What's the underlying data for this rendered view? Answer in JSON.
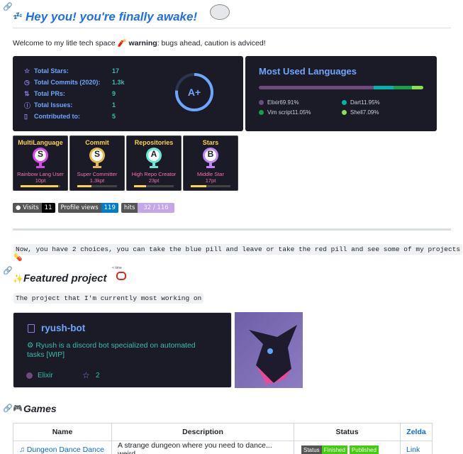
{
  "intro": {
    "title": "Hey you! you're finally awake!",
    "welcome_prefix": "Welcome to my litle tech space ",
    "warning_label": "warning",
    "welcome_suffix": ": bugs ahead, caution is adviced!"
  },
  "stats": {
    "rows": [
      {
        "icon": "star-icon",
        "label": "Total Stars:",
        "value": "17"
      },
      {
        "icon": "clock-icon",
        "label": "Total Commits (2020):",
        "value": "1.3k"
      },
      {
        "icon": "pull-request-icon",
        "label": "Total PRs:",
        "value": "9"
      },
      {
        "icon": "issue-icon",
        "label": "Total Issues:",
        "value": "1"
      },
      {
        "icon": "repo-icon",
        "label": "Contributed to:",
        "value": "5"
      }
    ],
    "grade": "A+",
    "colors": {
      "bg": "#1a1b27",
      "label": "#70a5fd",
      "value": "#38bdae",
      "ring": "#70a5fd"
    }
  },
  "languages": {
    "title": "Most Used Languages",
    "items": [
      {
        "name": "Elixir",
        "percent": "69.91%",
        "value": 69.91,
        "color": "#6e4a7e"
      },
      {
        "name": "Dart",
        "percent": "11.95%",
        "value": 11.95,
        "color": "#00B4AB"
      },
      {
        "name": "Vim script",
        "percent": "11.05%",
        "value": 11.05,
        "color": "#199f4b"
      },
      {
        "name": "Shell",
        "percent": "7.09%",
        "value": 7.09,
        "color": "#89e051"
      }
    ]
  },
  "trophies": [
    {
      "title": "MultiLanguage",
      "rank": "S",
      "subtitle": "Rainbow Lang User",
      "points": "10pt",
      "progress": 0.95,
      "cup_color": "#d946ef"
    },
    {
      "title": "Commit",
      "rank": "S",
      "subtitle": "Super Committer",
      "points": "1.3kpt",
      "progress": 0.35,
      "cup_color": "#e5b84b"
    },
    {
      "title": "Repositories",
      "rank": "A",
      "subtitle": "High Repo Creator",
      "points": "23pt",
      "progress": 0.3,
      "cup_color": "#5eead4"
    },
    {
      "title": "Stars",
      "rank": "B",
      "subtitle": "Middle Star",
      "points": "17pt",
      "progress": 0.4,
      "cup_color": "#c084fc"
    }
  ],
  "badges": {
    "visits_label": "Visits",
    "visits_value": "11",
    "profile_label": "Profile views",
    "profile_value": "119",
    "hits_label": "hits",
    "hits_value": "32 / 116"
  },
  "choices_text": "Now, you have 2 choices, you can take the blue pill and leave or take the red pill and see some of my projects",
  "featured": {
    "title": "Featured project",
    "sticker_text": "< time",
    "subtitle": "The project that I'm currently most working on",
    "repo_name": "ryush-bot",
    "repo_description": "Ryush is a discord bot specialized on automated tasks [WIP]",
    "language": "Elixir",
    "stars": "2"
  },
  "games": {
    "title": "Games",
    "headers": [
      "Name",
      "Description",
      "Status",
      "Zelda"
    ],
    "rows": [
      {
        "name": "Dungeon Dance Dance",
        "description": "A strange dungeon where you need to dance... weird",
        "status_label": "Status",
        "status_finished": "Finished",
        "status_published": "Published",
        "link": "Link"
      }
    ]
  }
}
